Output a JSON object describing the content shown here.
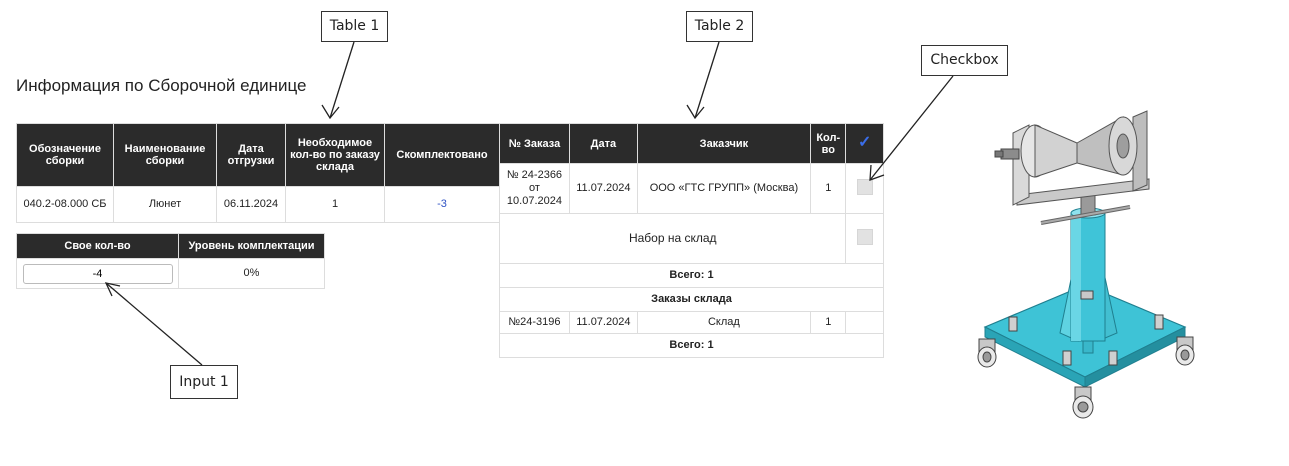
{
  "page_title": "Информация по Сборочной единице",
  "callouts": {
    "table1": "Table 1",
    "table2": "Table 2",
    "checkbox": "Checkbox",
    "input1": "Input 1"
  },
  "table1": {
    "headers": [
      "Обозначение сборки",
      "Наименование сборки",
      "Дата отгрузки",
      "Необходимое кол-во по заказу склада",
      "Скомплектовано"
    ],
    "row": {
      "designation": "040.2-08.000 СБ",
      "name": "Люнет",
      "ship_date": "06.11.2024",
      "required_qty": "1",
      "completed": "-3"
    }
  },
  "own_table": {
    "headers": [
      "Свое кол-во",
      "Уровень комплектации"
    ],
    "input_value": "-4",
    "completion_level": "0%"
  },
  "table2": {
    "headers": [
      "№ Заказа",
      "Дата",
      "Заказчик",
      "Кол-во"
    ],
    "check_header_icon": "checkmark-icon",
    "orders": [
      {
        "number": "№ 24-2366 от 10.07.2024",
        "date": "11.07.2024",
        "customer": "ООО «ГТС ГРУПП» (Москва)",
        "qty": "1"
      }
    ],
    "stock_set_label": "Набор на склад",
    "total1": "Всего: 1",
    "warehouse_orders_label": "Заказы склада",
    "warehouse_orders": [
      {
        "number": "№24-3196",
        "date": "11.07.2024",
        "customer": "Склад",
        "qty": "1"
      }
    ],
    "total2": "Всего: 1"
  },
  "colors": {
    "header_bg": "#2b2b2b",
    "accent_blue": "#2f52c4",
    "check_blue": "#3a6de8",
    "product_cyan": "#3fc4d8"
  },
  "product_image": "3d-render-pipe-roller-stand"
}
